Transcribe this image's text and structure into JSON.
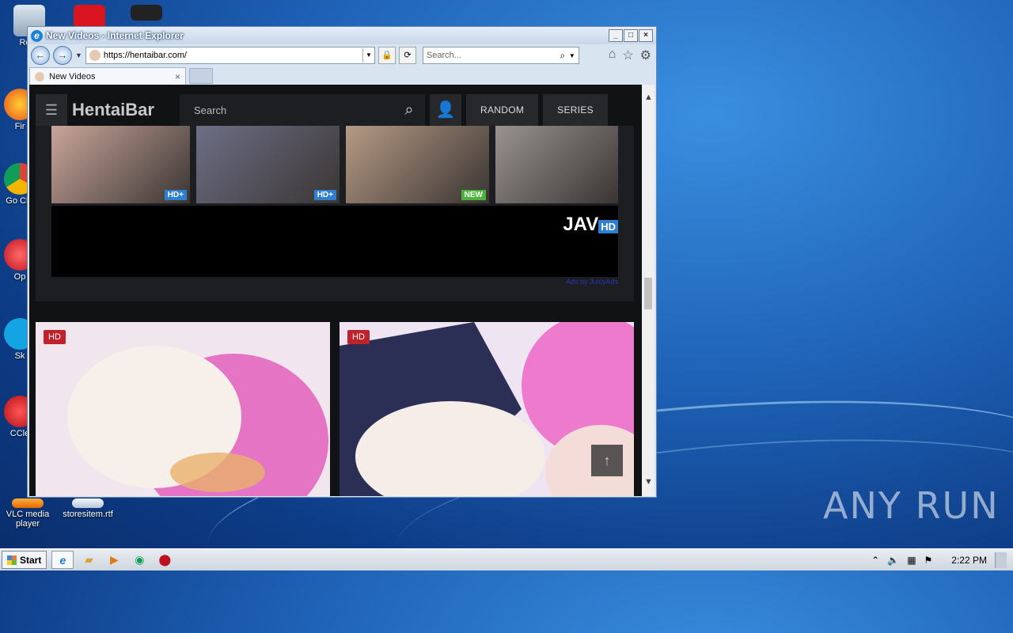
{
  "desktop": {
    "icons": [
      {
        "label": "Recy"
      },
      {
        "label": "Fir"
      },
      {
        "label": "Go Chr"
      },
      {
        "label": "Op"
      },
      {
        "label": "Sk"
      },
      {
        "label": "CCle"
      },
      {
        "label": "VLC media player"
      },
      {
        "label": "storesitem.rtf"
      }
    ],
    "watermark": "ANY RUN"
  },
  "window": {
    "title": "New Videos - Internet Explorer",
    "address": "https://hentaibar.com/",
    "search_placeholder": "Search...",
    "tab_label": "New Videos"
  },
  "site": {
    "brand": "HentaiBar",
    "search_placeholder": "Search",
    "nav": [
      "RANDOM",
      "SERIES"
    ],
    "ad": {
      "thumbs": [
        {
          "badge": "HD+",
          "tone": "#c9a59a"
        },
        {
          "badge": "HD+",
          "tone": "#6e6f86"
        },
        {
          "badge": "NEW",
          "tone": "#b59a84"
        },
        {
          "badge": "",
          "tone": "#9a9490"
        }
      ],
      "logo_text": "JAV",
      "logo_badge": "HD",
      "link": "Ads by JuicyAds"
    },
    "cards": [
      {
        "badge": "HD",
        "tone": "#efdde8"
      },
      {
        "badge": "HD",
        "tone": "#e7d8ee"
      }
    ],
    "scroll_top": "↑"
  },
  "taskbar": {
    "start_label": "Start",
    "clock": "2:22 PM"
  }
}
